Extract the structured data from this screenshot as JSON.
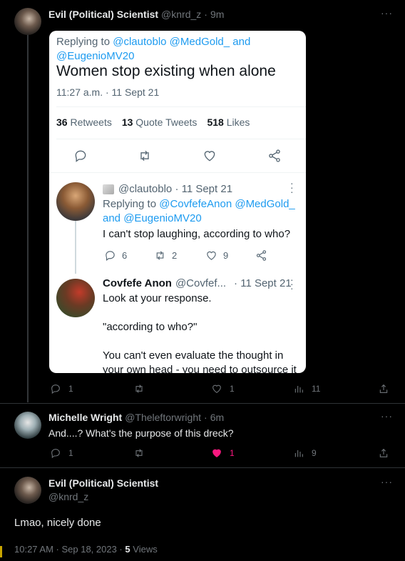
{
  "tweet1": {
    "name": "Evil (Political) Scientist",
    "handle": "@knrd_z",
    "dot": "·",
    "time": "9m",
    "more": "···",
    "stats": {
      "replies": "1",
      "retweets": "",
      "likes": "1",
      "views": "11"
    }
  },
  "embed": {
    "replying_prefix": "Replying to",
    "replying_to": "@clautoblo @MedGold_ and",
    "replying_to_2": "@EugenioMV20",
    "text": "Women stop existing when alone",
    "timestamp": "11:27 a.m. · 11 Sept 21",
    "retweets_count": "36",
    "retweets_label": "Retweets",
    "quotes_count": "13",
    "quotes_label": "Quote Tweets",
    "likes_count": "518",
    "likes_label": "Likes",
    "reply1": {
      "handle_time": "@clautoblo · 11 Sept 21",
      "replying_prefix": "Replying to",
      "replying_to": "@CovfefeAnon @MedGold_",
      "replying_to_2": "and @EugenioMV20",
      "text": "I can't stop laughing, according to who?",
      "replies": "6",
      "retweets": "2",
      "likes": "9"
    },
    "reply2": {
      "name": "Covfefe Anon",
      "handle": "@Covfef...",
      "time": "· 11 Sept 21",
      "line1": "Look at your response.",
      "line2": "\"according to who?\"",
      "line3": "You can't even evaluate the thought in",
      "line4": "your own head - you need to outsource it"
    }
  },
  "tweet2": {
    "name": "Michelle Wright",
    "handle": "@Theleftorwright",
    "dot": "·",
    "time": "6m",
    "more": "···",
    "text": "And....? What's the purpose of this dreck?",
    "stats": {
      "replies": "1",
      "likes": "1",
      "views": "9"
    }
  },
  "tweet3": {
    "name": "Evil (Political) Scientist",
    "handle": "@knrd_z",
    "more": "···",
    "text": "Lmao, nicely done",
    "timestamp": "10:27 AM · Sep 18, 2023 ·",
    "views_count": "5",
    "views_label": "Views"
  },
  "colors": {
    "like_active": "#f91880",
    "link": "#1d9bf0",
    "muted": "#71767b"
  }
}
